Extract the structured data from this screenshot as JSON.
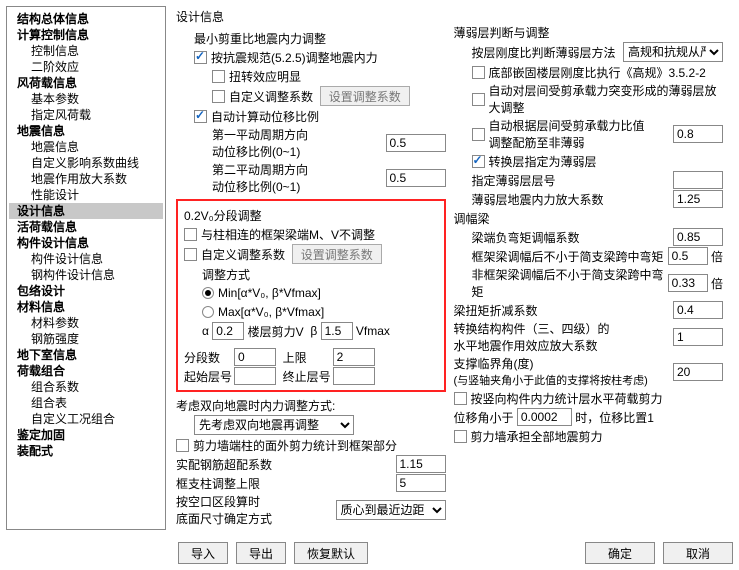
{
  "tree": {
    "t1": "结构总体信息",
    "t2": "计算控制信息",
    "t2a": "控制信息",
    "t2b": "二阶效应",
    "t3": "风荷载信息",
    "t3a": "基本参数",
    "t3b": "指定风荷载",
    "t4": "地震信息",
    "t4a": "地震信息",
    "t4b": "自定义影响系数曲线",
    "t4c": "地震作用放大系数",
    "t4d": "性能设计",
    "t5": "设计信息",
    "t6": "活荷载信息",
    "t7": "构件设计信息",
    "t7a": "构件设计信息",
    "t7b": "钢构件设计信息",
    "t8": "包络设计",
    "t9": "材料信息",
    "t9a": "材料参数",
    "t9b": "钢筋强度",
    "t10": "地下室信息",
    "t11": "荷载组合",
    "t11a": "组合系数",
    "t11b": "组合表",
    "t11c": "自定义工况组合",
    "t12": "鉴定加固",
    "t13": "装配式"
  },
  "left": {
    "design_title": "设计信息",
    "min_shear": "最小剪重比地震内力调整",
    "adj_525": "按抗震规范(5.2.5)调整地震内力",
    "twist": "扭转效应明显",
    "custom_coef": "自定义调整系数",
    "set_coef_btn": "设置调整系数",
    "auto_disp": "自动计算动位移比例",
    "p1a": "第一平动周期方向",
    "p1b": "动位移比例(0~1)",
    "v1": "0.5",
    "p2a": "第二平动周期方向",
    "p2b": "动位移比例(0~1)",
    "v2": "0.5",
    "red_title": "0.2V₀分段调整",
    "no_adjust_mv": "与柱相连的框架梁端M、V不调整",
    "custom2": "自定义调整系数",
    "set_coef_btn2": "设置调整系数",
    "method": "调整方式",
    "min_fn": "Min[α*V₀,  β*Vfmax]",
    "max_fn": "Max[α*V₀,  β*Vfmax]",
    "alpha_l": "α",
    "alpha_v": "0.2",
    "shear_l": "楼层剪力V",
    "beta_l": "β",
    "beta_v": "1.5",
    "vfmax": "Vfmax",
    "seg_n": "分段数",
    "seg_v": "0",
    "upper": "上限",
    "upper_v": "2",
    "start_floor": "起始层号",
    "end_floor": "终止层号",
    "dbl_title": "考虑双向地震时内力调整方式:",
    "dbl_sel": "先考虑双向地震再调整",
    "wall_col": "剪力墙端柱的面外剪力统计到框架部分",
    "rebar_l": "实配钢筋超配系数",
    "rebar_v": "1.15",
    "frame_upper": "框支柱调整上限",
    "frame_v": "5",
    "area_l1": "按空口区段算时",
    "area_l2": "底面尺寸确定方式",
    "area_sel": "质心到最近边距"
  },
  "right": {
    "weak_title": "薄弱层判断与调整",
    "method_l": "按层刚度比判断薄弱层方法",
    "method_sel": "高规和抗规从严",
    "basement": "底部嵌固楼层刚度比执行《高规》3.5.2-2",
    "auto_thin": "自动对层间受剪承载力突变形成的薄弱层放大调整",
    "auto_ratio_a": "自动根据层间受剪承载力比值",
    "auto_ratio_b": "调整配筋至非薄弱",
    "auto_ratio_v": "0.8",
    "conv": "转换层指定为薄弱层",
    "thin_no": "指定薄弱层层号",
    "thin_amp_l": "薄弱层地震内力放大系数",
    "thin_amp_v": "1.25",
    "tune_title": "调幅梁",
    "neg_bend": "梁端负弯矩调幅系数",
    "neg_v": "0.85",
    "beam_frame": "框架梁调幅后不小于简支梁跨中弯矩",
    "beam_fv": "0.5",
    "times": "倍",
    "nonframe": "非框架梁调幅后不小于简支梁跨中弯矩",
    "nonf_v": "0.33",
    "tor_title": "梁扭矩折减系数",
    "tor_v": "0.4",
    "struct34a": "转换结构构件（三、四级）的",
    "struct34b": "水平地震作用效应放大系数",
    "struct34_v": "1",
    "support_a": "支撑临界角(度)",
    "support_b": "(与竖轴夹角小于此值的支撑将按柱考虑)",
    "support_v": "20",
    "per_member": "按竖向构件内力统计层水平荷载剪力",
    "disp_l": "位移角小于",
    "disp_v": "0.0002",
    "disp_r": "时，位移比置1",
    "wall_all": "剪力墙承担全部地震剪力"
  },
  "footer": {
    "imp": "导入",
    "exp": "导出",
    "rst": "恢复默认",
    "ok": "确定",
    "cancel": "取消"
  }
}
